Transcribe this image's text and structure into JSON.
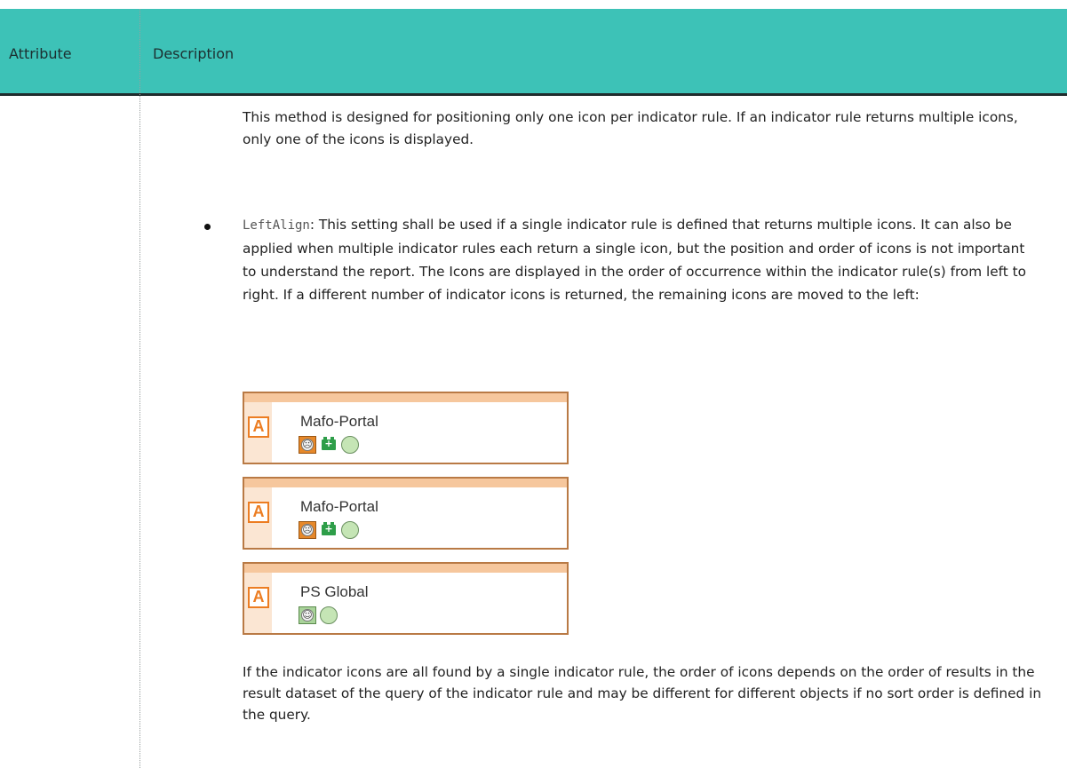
{
  "table": {
    "header": {
      "attribute": "Attribute",
      "description": "Description"
    }
  },
  "content": {
    "para1": "This method is designed for positioning only one icon per indicator rule. If an indicator rule returns multiple icons, only one of the icons is displayed.",
    "bullet": {
      "code": "LeftAlign",
      "text": ": This setting shall be used if a single indicator rule is defined that returns multiple icons. It can also be applied when multiple indicator rules each return a single icon, but the position and order of icons is not important to understand the report. The Icons are displayed in the order of occurrence within the indicator rule(s) from left to right. If a different number of indicator icons is returned, the remaining icons are moved to the left:"
    },
    "para3": "If the indicator icons are all found by a single indicator rule, the order of icons depends on the order of results in the result dataset of the query of the indicator rule and may be different for different objects if no sort order is defined in the query."
  },
  "figure": {
    "objects": [
      {
        "logo": "A",
        "label": "Mafo-Portal",
        "icons": [
          "sad-face-icon",
          "battery-icon",
          "green-circle-icon"
        ]
      },
      {
        "logo": "A",
        "label": "Mafo-Portal",
        "icons": [
          "sad-face-icon",
          "battery-icon",
          "green-circle-icon"
        ]
      },
      {
        "logo": "A",
        "label": "PS Global",
        "icons": [
          "happy-face-icon",
          "green-circle-icon"
        ]
      }
    ]
  }
}
